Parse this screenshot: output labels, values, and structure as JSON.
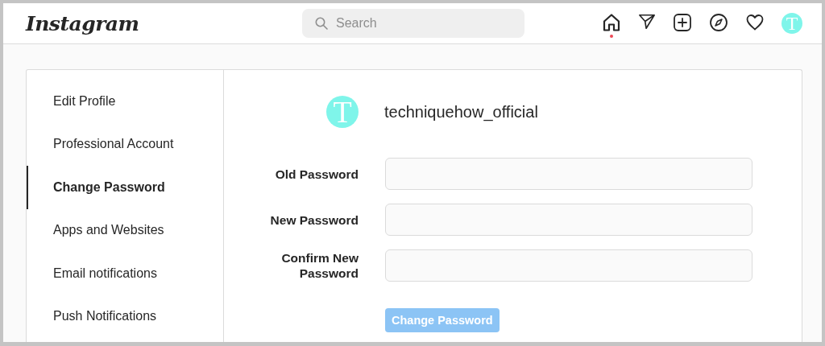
{
  "header": {
    "logo": "Instagram",
    "search": {
      "placeholder": "Search"
    },
    "nav": [
      {
        "kind": "home",
        "selected": true,
        "activity_dot": true
      },
      {
        "kind": "send",
        "selected": false,
        "activity_dot": false
      },
      {
        "kind": "add",
        "selected": false,
        "activity_dot": false
      },
      {
        "kind": "explore",
        "selected": false,
        "activity_dot": false
      },
      {
        "kind": "heart",
        "selected": false,
        "activity_dot": false
      },
      {
        "kind": "avatar",
        "letter": "T",
        "selected": false,
        "activity_dot": false
      }
    ]
  },
  "sidebar": {
    "items": [
      {
        "label": "Edit Profile",
        "selected": false
      },
      {
        "label": "Professional Account",
        "selected": false
      },
      {
        "label": "Change Password",
        "selected": true
      },
      {
        "label": "Apps and Websites",
        "selected": false
      },
      {
        "label": "Email notifications",
        "selected": false
      },
      {
        "label": "Push Notifications",
        "selected": false
      }
    ]
  },
  "profile": {
    "avatar_letter": "T",
    "username": "techniquehow_official"
  },
  "form": {
    "fields": [
      {
        "label": "Old Password"
      },
      {
        "label": "New Password"
      },
      {
        "label": "Confirm New Password"
      }
    ],
    "submit": {
      "label": "Change Password",
      "disabled": true
    }
  }
}
